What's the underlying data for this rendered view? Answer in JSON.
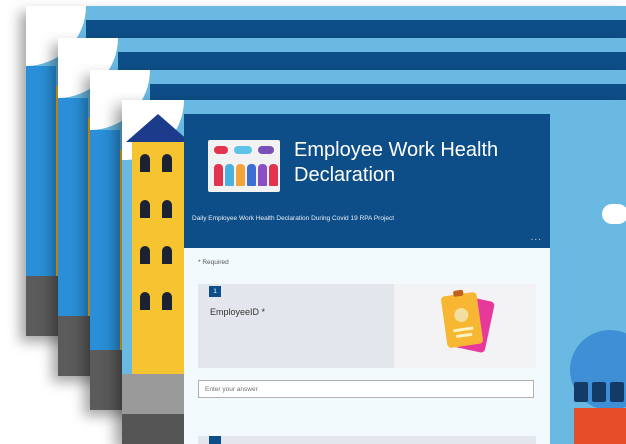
{
  "form": {
    "title": "Employee Work Health Declaration",
    "subtitle": "Daily Employee Work Health Declaration During Covid 19 RPA Project",
    "more_menu": "...",
    "required_note": "* Required",
    "questions": [
      {
        "number": "1",
        "label": "EmployeeID *",
        "placeholder": "Enter your answer"
      }
    ]
  },
  "colors": {
    "header_blue": "#0e4e88",
    "sky_blue": "#69b9e2",
    "building_yellow": "#f7c431"
  },
  "icons": [
    "health-team-logo-icon",
    "id-card-icon",
    "more-options-icon"
  ]
}
